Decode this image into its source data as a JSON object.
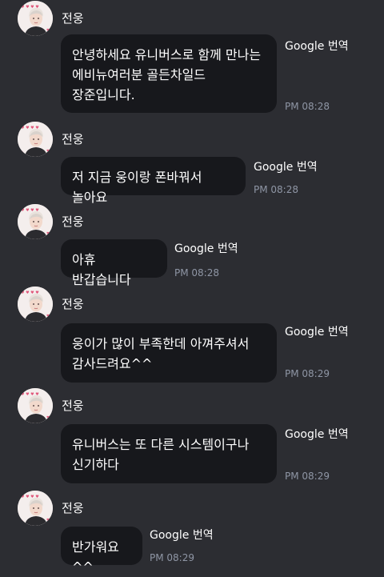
{
  "messages": [
    {
      "sender": "전웅",
      "text": "안녕하세요 유니버스로 함께 만나는 에비뉴여러분 골든차일드 장준입니다.",
      "translate_label": "Google 번역",
      "time": "PM 08:28",
      "avatar_icon": "profile-photo"
    },
    {
      "sender": "전웅",
      "text": "저 지금 웅이랑 폰바꿔서 놀아요",
      "translate_label": "Google 번역",
      "time": "PM 08:28",
      "avatar_icon": "profile-photo"
    },
    {
      "sender": "전웅",
      "text": "아휴 반갑습니다",
      "translate_label": "Google 번역",
      "time": "PM 08:28",
      "avatar_icon": "profile-photo"
    },
    {
      "sender": "전웅",
      "text": "웅이가 많이 부족한데 아껴주셔서 감사드려요^^",
      "translate_label": "Google 번역",
      "time": "PM 08:29",
      "avatar_icon": "profile-photo"
    },
    {
      "sender": "전웅",
      "text": "유니버스는 또 다른 시스템이구나 신기하다",
      "translate_label": "Google 번역",
      "time": "PM 08:29",
      "avatar_icon": "profile-photo"
    },
    {
      "sender": "전웅",
      "text": "반가워요^^",
      "translate_label": "Google 번역",
      "time": "PM 08:29",
      "avatar_icon": "profile-photo"
    }
  ],
  "colors": {
    "background": "#2c2d32",
    "bubble": "#17181c",
    "text": "#ffffff",
    "timestamp": "#8f96a5"
  }
}
